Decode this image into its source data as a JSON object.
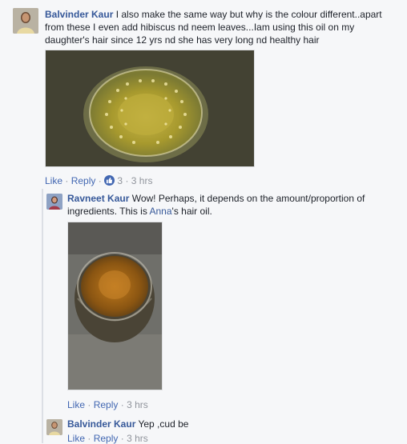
{
  "comments": [
    {
      "author": "Balvinder Kaur",
      "text": " I also make the same way but why is the colour different..apart from these I even add hibiscus nd neem leaves...Iam using this oil on my daughter's hair since 12 yrs nd she has very long nd healthy hair",
      "like_label": "Like",
      "reply_label": "Reply",
      "reaction_count": "3",
      "time": "3 hrs"
    },
    {
      "author": "Ravneet Kaur",
      "text_before": " Wow! Perhaps, it depends on the amount/proportion of ingredients. This is ",
      "mention": "Anna",
      "text_after": "'s hair oil.",
      "like_label": "Like",
      "reply_label": "Reply",
      "time": "3 hrs"
    },
    {
      "author": "Balvinder Kaur",
      "text": " Yep ,cud be",
      "like_label": "Like",
      "reply_label": "Reply",
      "time": "3 hrs"
    }
  ],
  "separator": "·",
  "colors": {
    "link": "#365899",
    "meta": "#90949c",
    "like": "#4267b2"
  },
  "icons": {
    "reaction": "thumbs-up-icon"
  }
}
